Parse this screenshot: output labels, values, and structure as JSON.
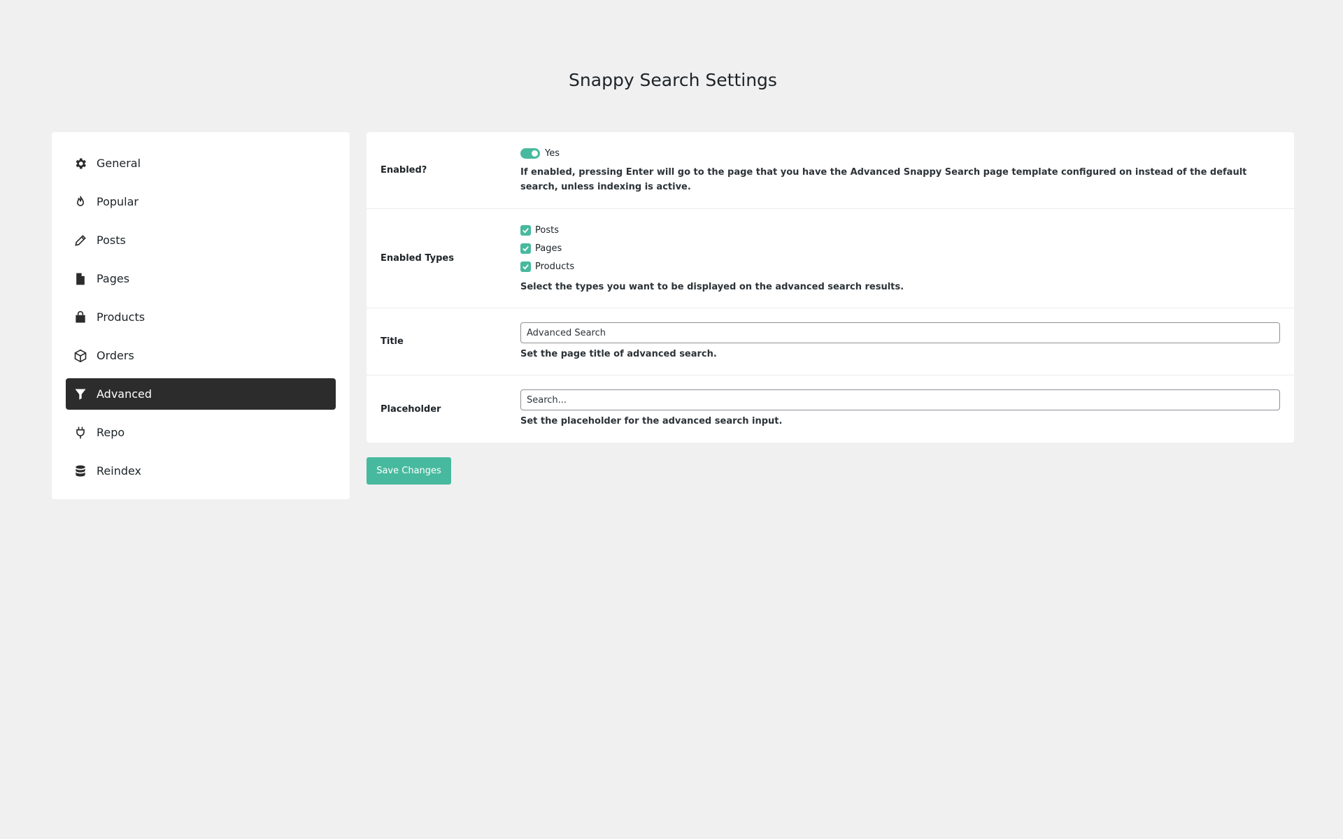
{
  "page": {
    "title": "Snappy Search Settings"
  },
  "sidebar": {
    "items": [
      {
        "label": "General",
        "icon": "gear-icon",
        "active": false
      },
      {
        "label": "Popular",
        "icon": "fire-icon",
        "active": false
      },
      {
        "label": "Posts",
        "icon": "pencil-icon",
        "active": false
      },
      {
        "label": "Pages",
        "icon": "file-icon",
        "active": false
      },
      {
        "label": "Products",
        "icon": "shopping-bag-icon",
        "active": false
      },
      {
        "label": "Orders",
        "icon": "box-icon",
        "active": false
      },
      {
        "label": "Advanced",
        "icon": "filter-icon",
        "active": true
      },
      {
        "label": "Repo",
        "icon": "plug-icon",
        "active": false
      },
      {
        "label": "Reindex",
        "icon": "database-icon",
        "active": false
      }
    ]
  },
  "settings": {
    "enabled": {
      "label": "Enabled?",
      "toggle_label": "Yes",
      "value": true,
      "description": "If enabled, pressing Enter will go to the page that you have the Advanced Snappy Search page template configured on instead of the default search, unless indexing is active."
    },
    "types": {
      "label": "Enabled Types",
      "options": [
        {
          "label": "Posts",
          "checked": true
        },
        {
          "label": "Pages",
          "checked": true
        },
        {
          "label": "Products",
          "checked": true
        }
      ],
      "description": "Select the types you want to be displayed on the advanced search results."
    },
    "title": {
      "label": "Title",
      "value": "Advanced Search",
      "description": "Set the page title of advanced search."
    },
    "placeholder": {
      "label": "Placeholder",
      "value": "Search...",
      "description": "Set the placeholder for the advanced search input."
    }
  },
  "actions": {
    "save_label": "Save Changes"
  },
  "colors": {
    "accent": "#47b99e",
    "active_nav": "#2c2c2c",
    "background": "#f0f0f1"
  }
}
